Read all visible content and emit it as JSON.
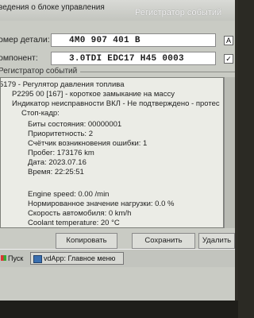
{
  "header": {
    "left_title": "ведения о блоке управления",
    "right_title": "Регистратор событий"
  },
  "fields": [
    {
      "label": "омер детали:",
      "value": "4M0 907 401 B"
    },
    {
      "label": "омпонент:",
      "value": "3.0TDI EDC17  H45 0003"
    }
  ],
  "checkbox_marks": [
    "A",
    "✓"
  ],
  "log": {
    "group_label": "Регистратор событий",
    "lines": [
      "5179 - Регулятор давления топлива",
      "P2295 00 [167] - короткое замыкание на массу",
      "Индикатор неисправности ВКЛ - Не подтверждено - протес",
      "Стоп-кадр:",
      "Биты состояния: 00000001",
      "Приоритетность: 2",
      "Счётчик возникновения ошибки: 1",
      "Пробег: 173176 km",
      "Дата: 2023.07.16",
      "Время: 22:25:51",
      "Engine speed: 0.00 /min",
      "Нормированное значение нагрузки: 0.0 %",
      "Скорость автомобиля: 0 km/h",
      "Coolant temperature: 20 °C"
    ]
  },
  "buttons": {
    "copy": "Копировать",
    "save": "Сохранить",
    "delete": "Удалить"
  },
  "taskbar": {
    "start": "Пуск",
    "task": "vdApp: Главное меню"
  }
}
